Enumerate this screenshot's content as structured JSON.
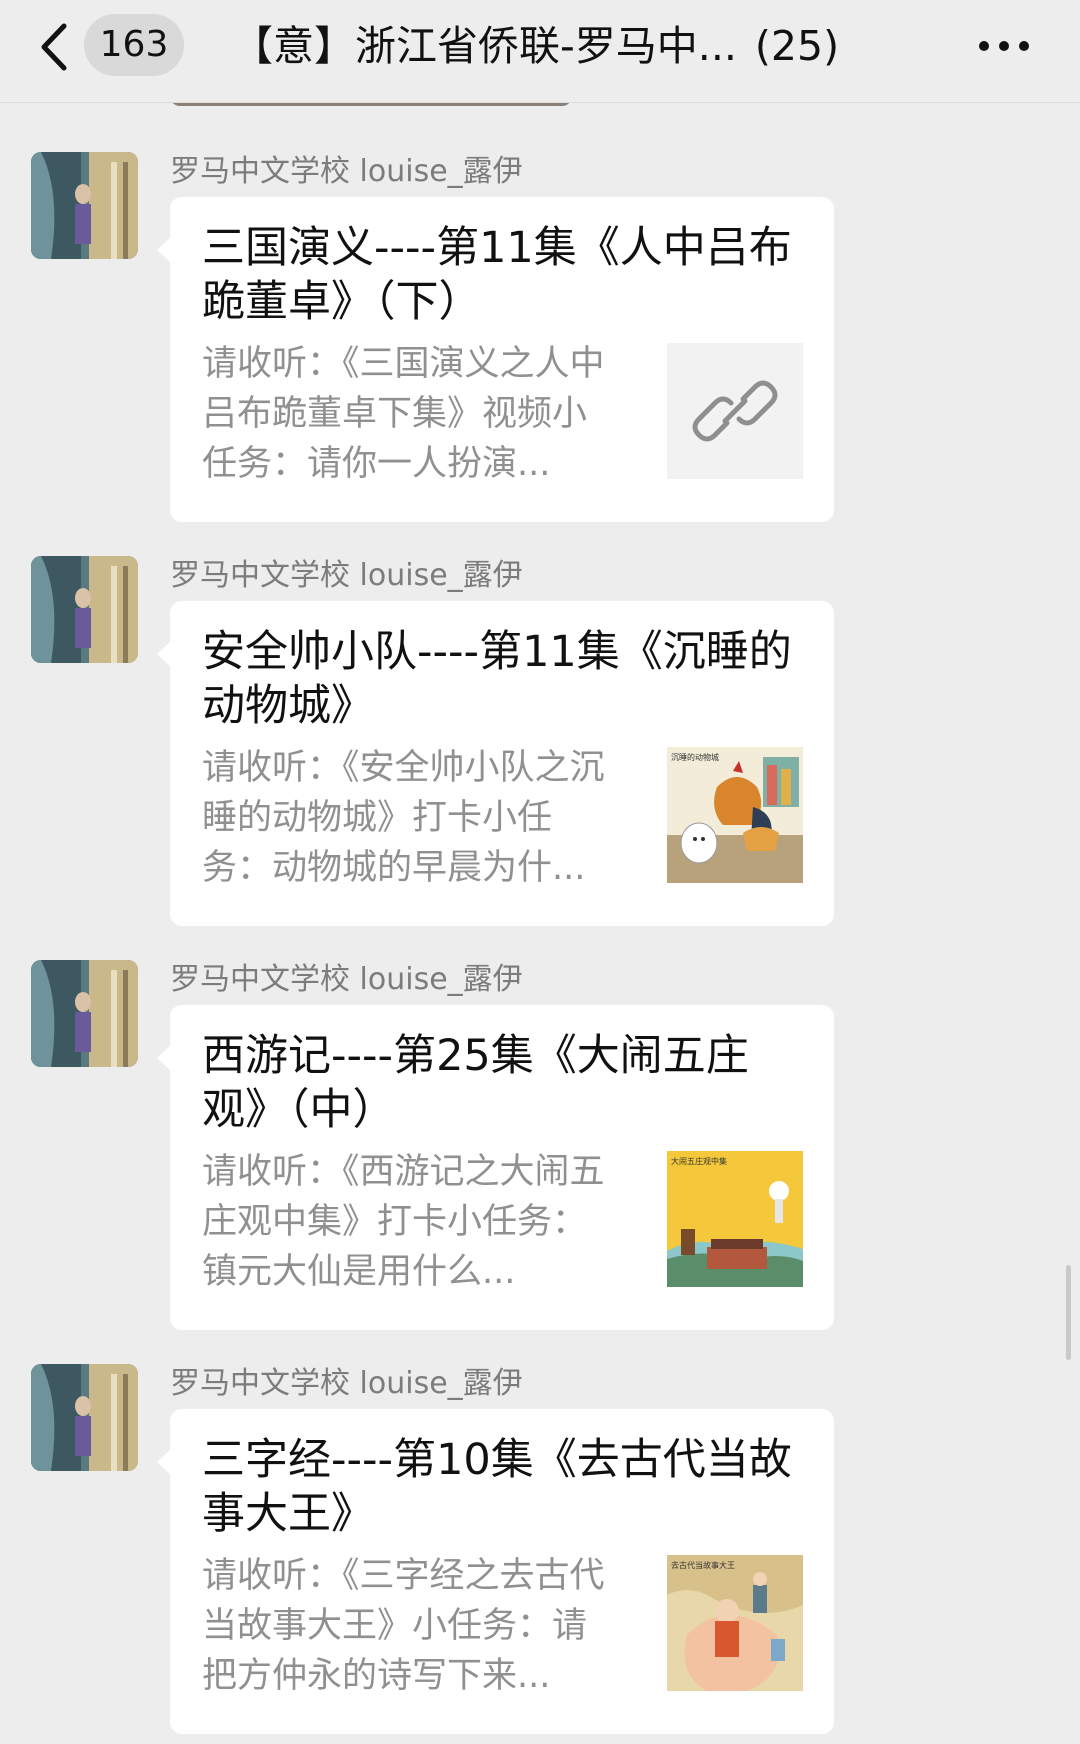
{
  "header": {
    "unread_count": "163",
    "title": "【意】浙江省侨联-罗马中...",
    "member_count": "(25)"
  },
  "messages": [
    {
      "sender": "罗马中文学校 louise_露伊",
      "title": "三国演义----第11集《人中吕布跪董卓》（下）",
      "description": "请收听：《三国演义之人中吕布跪董卓下集》视频小任务：请你一人扮演...",
      "thumbnail": "link-icon"
    },
    {
      "sender": "罗马中文学校 louise_露伊",
      "title": "安全帅小队----第11集《沉睡的动物城》",
      "description": "请收听：《安全帅小队之沉睡的动物城》打卡小任务：动物城的早晨为什...",
      "thumbnail": "animal-city-cover-image",
      "thumb_caption": "沉睡的动物城"
    },
    {
      "sender": "罗马中文学校 louise_露伊",
      "title": "西游记----第25集《大闹五庄观》（中）",
      "description": "请收听：《西游记之大闹五庄观中集》打卡小任务：镇元大仙是用什么...",
      "thumbnail": "wuzhuang-temple-cover-image",
      "thumb_caption": "大闹五庄观中集"
    },
    {
      "sender": "罗马中文学校 louise_露伊",
      "title": "三字经----第10集《去古代当故事大王》",
      "description": "请收听：《三字经之去古代当故事大王》小任务：请把方仲永的诗写下来...",
      "thumbnail": "ancient-storyteller-cover-image",
      "thumb_caption": "去古代当故事大王"
    }
  ],
  "colors": {
    "background": "#ededed",
    "bubble": "#ffffff",
    "sender_text": "#7c7c7c",
    "desc_text": "#909090"
  }
}
